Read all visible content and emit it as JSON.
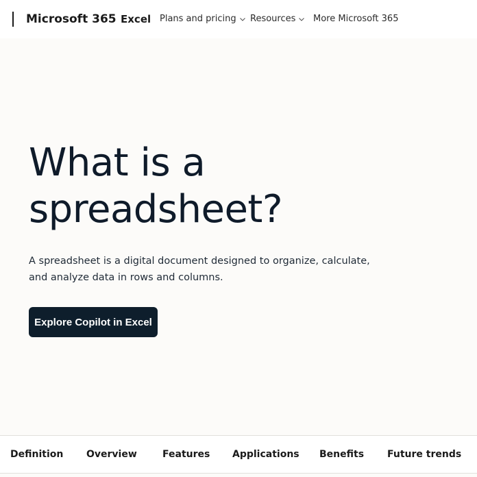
{
  "header": {
    "brand": "Microsoft 365",
    "product": "Excel",
    "nav": [
      {
        "label": "Plans and pricing",
        "icon": "chevron-down-icon"
      },
      {
        "label": "Resources",
        "icon": "chevron-down-icon"
      },
      {
        "label": "More Microsoft 365"
      }
    ]
  },
  "hero": {
    "title_line1": "What is a",
    "title_line2": "spreadsheet?",
    "description": "A spreadsheet is a digital document designed to organize, calculate, and analyze data in rows and columns.",
    "cta_label": "Explore Copilot in Excel"
  },
  "subnav": {
    "items": [
      "Definition",
      "Overview",
      "Features",
      "Applications",
      "Benefits",
      "Future trends"
    ]
  },
  "colors": {
    "page_background": "#fcfbf9",
    "cta_background": "#0e1e2c",
    "title_text": "#0f1b2a"
  }
}
